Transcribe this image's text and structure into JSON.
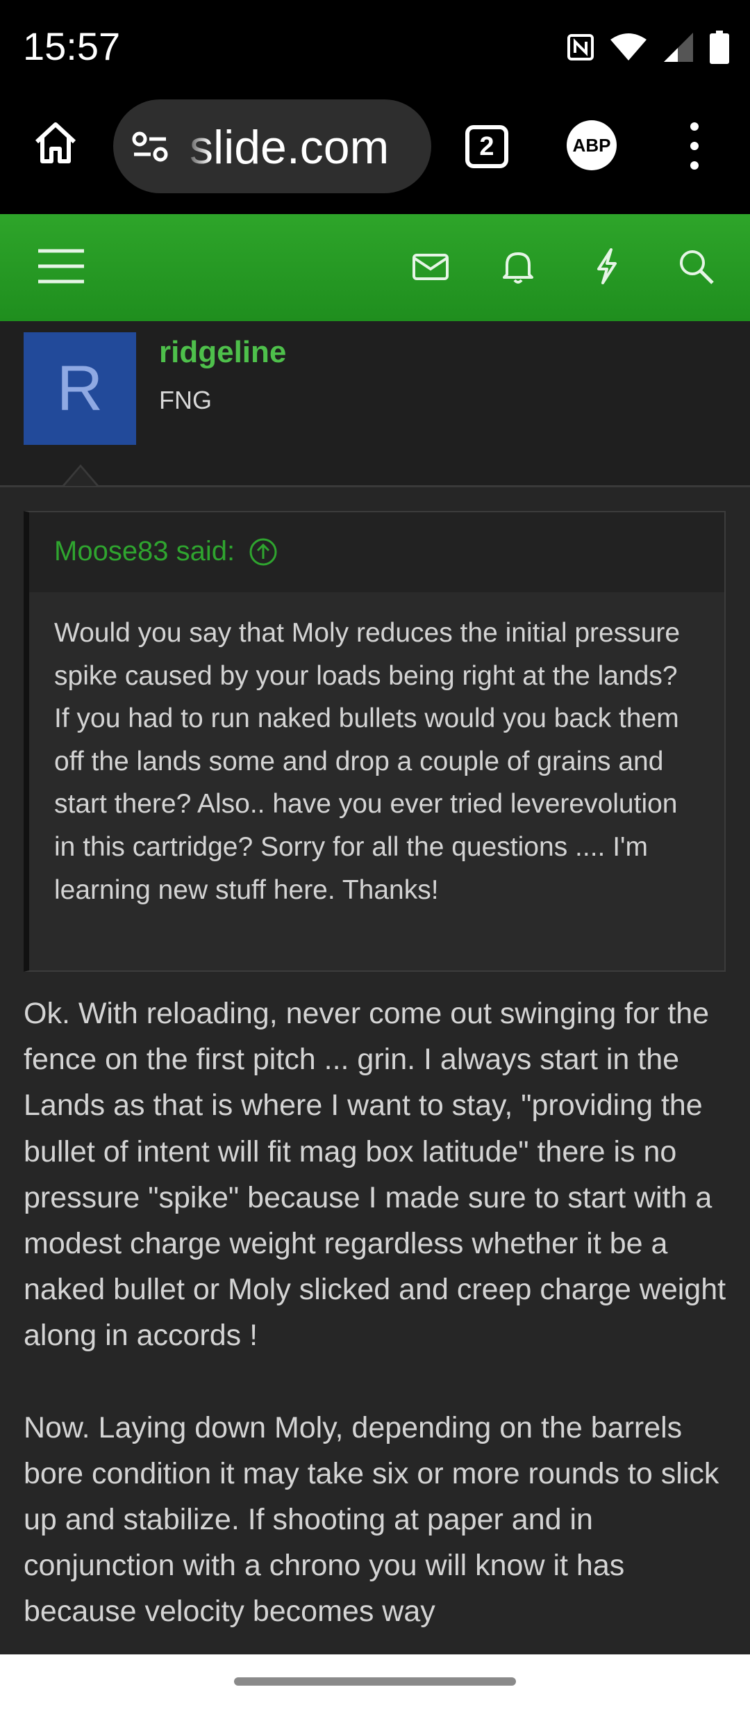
{
  "status_bar": {
    "time": "15:57",
    "icons": [
      "nfc-icon",
      "wifi-icon",
      "signal-icon",
      "battery-icon"
    ]
  },
  "browser": {
    "url_text": "slide.com",
    "tab_count": "2",
    "adblock_label": "ABP",
    "icons": [
      "home-icon",
      "site-settings-icon",
      "tabs-icon",
      "adblock-icon",
      "more-vert-icon"
    ]
  },
  "site_header": {
    "accent_color": "#2ea52a",
    "icons": [
      "hamburger-icon",
      "mail-icon",
      "bell-icon",
      "lightning-icon",
      "search-icon"
    ]
  },
  "user": {
    "avatar_letter": "R",
    "name": "ridgeline",
    "title": "FNG"
  },
  "quote": {
    "author": "Moose83 said:",
    "text": "Would you say that Moly reduces the initial pressure spike caused by your loads being right at the lands? If you had to run naked bullets would you back them off the lands some and drop a couple of grains and start there? Also.. have you ever tried leverevolution in this cartridge? Sorry for all the questions .... I'm learning new stuff here. Thanks!"
  },
  "post": {
    "paragraph_1": "Ok. With reloading, never come out swinging for the fence on the first pitch ... grin. I always start in the Lands as that is where I want to stay, \"providing the bullet of intent will fit mag box latitude\" there is no pressure \"spike\" because I made sure to start with a modest charge weight regardless whether it be a naked bullet or Moly slicked and creep charge weight along in accords !",
    "paragraph_2": "Now. Laying down Moly, depending on the barrels bore condition it may take six or more rounds to slick up and stabilize. If shooting at paper and in conjunction with a chrono you will know it has because velocity becomes way"
  }
}
